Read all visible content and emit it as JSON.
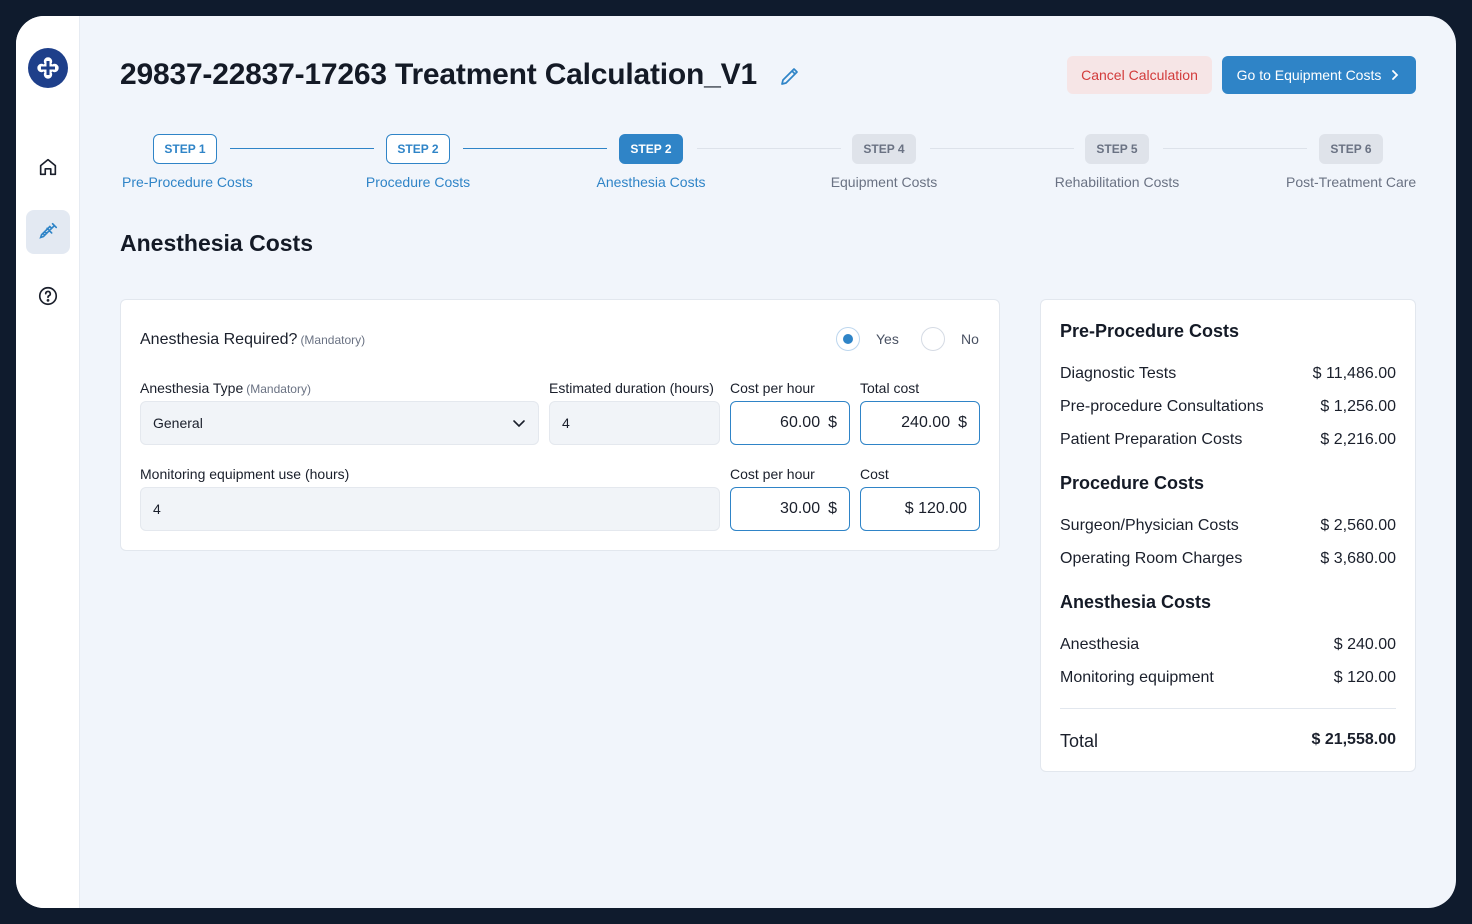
{
  "header": {
    "title": "29837-22837-17263 Treatment Calculation_V1",
    "cancel_label": "Cancel Calculation",
    "next_label": "Go to Equipment Costs"
  },
  "steps": [
    {
      "badge": "STEP 1",
      "label": "Pre-Procedure Costs",
      "state": "done"
    },
    {
      "badge": "STEP 2",
      "label": "Procedure Costs",
      "state": "done"
    },
    {
      "badge": "STEP 2",
      "label": "Anesthesia Costs",
      "state": "active"
    },
    {
      "badge": "STEP 4",
      "label": "Equipment Costs",
      "state": "todo"
    },
    {
      "badge": "STEP 5",
      "label": "Rehabilitation Costs",
      "state": "todo"
    },
    {
      "badge": "STEP 6",
      "label": "Post-Treatment Care",
      "state": "todo"
    }
  ],
  "section_title": "Anesthesia Costs",
  "form": {
    "question": "Anesthesia Required?",
    "mandatory": "(Mandatory)",
    "yes_label": "Yes",
    "no_label": "No",
    "selected": "Yes",
    "type_label": "Anesthesia Type",
    "type_value": "General",
    "duration_label": "Estimated duration (hours)",
    "duration_value": "4",
    "cost_per_hour_label": "Cost per hour",
    "cost_per_hour_value": "60.00",
    "total_cost_label": "Total cost",
    "total_cost_value": "240.00",
    "monitoring_label": "Monitoring equipment use (hours)",
    "monitoring_value": "4",
    "monitoring_cph_label": "Cost per hour",
    "monitoring_cph_value": "30.00",
    "monitoring_cost_label": "Cost",
    "monitoring_cost_value": "$ 120.00",
    "currency": "$"
  },
  "summary": {
    "groups": [
      {
        "title": "Pre-Procedure Costs",
        "rows": [
          {
            "label": "Diagnostic Tests",
            "amount": "$ 11,486.00"
          },
          {
            "label": "Pre-procedure Consultations",
            "amount": "$ 1,256.00"
          },
          {
            "label": "Patient Preparation Costs",
            "amount": "$ 2,216.00"
          }
        ]
      },
      {
        "title": "Procedure Costs",
        "rows": [
          {
            "label": "Surgeon/Physician Costs",
            "amount": "$ 2,560.00"
          },
          {
            "label": "Operating Room Charges",
            "amount": "$ 3,680.00"
          }
        ]
      },
      {
        "title": "Anesthesia Costs",
        "rows": [
          {
            "label": "Anesthesia",
            "amount": "$ 240.00"
          },
          {
            "label": "Monitoring equipment",
            "amount": "$ 120.00"
          }
        ]
      }
    ],
    "total_label": "Total",
    "total_amount": "$ 21,558.00"
  },
  "colors": {
    "accent": "#2f84c7",
    "danger": "#d23b3b",
    "brand": "#1e3f8a"
  },
  "icons": [
    "logo-icon",
    "home-icon",
    "syringe-icon",
    "help-icon",
    "pencil-icon",
    "chevron-right-icon",
    "chevron-down-icon"
  ]
}
